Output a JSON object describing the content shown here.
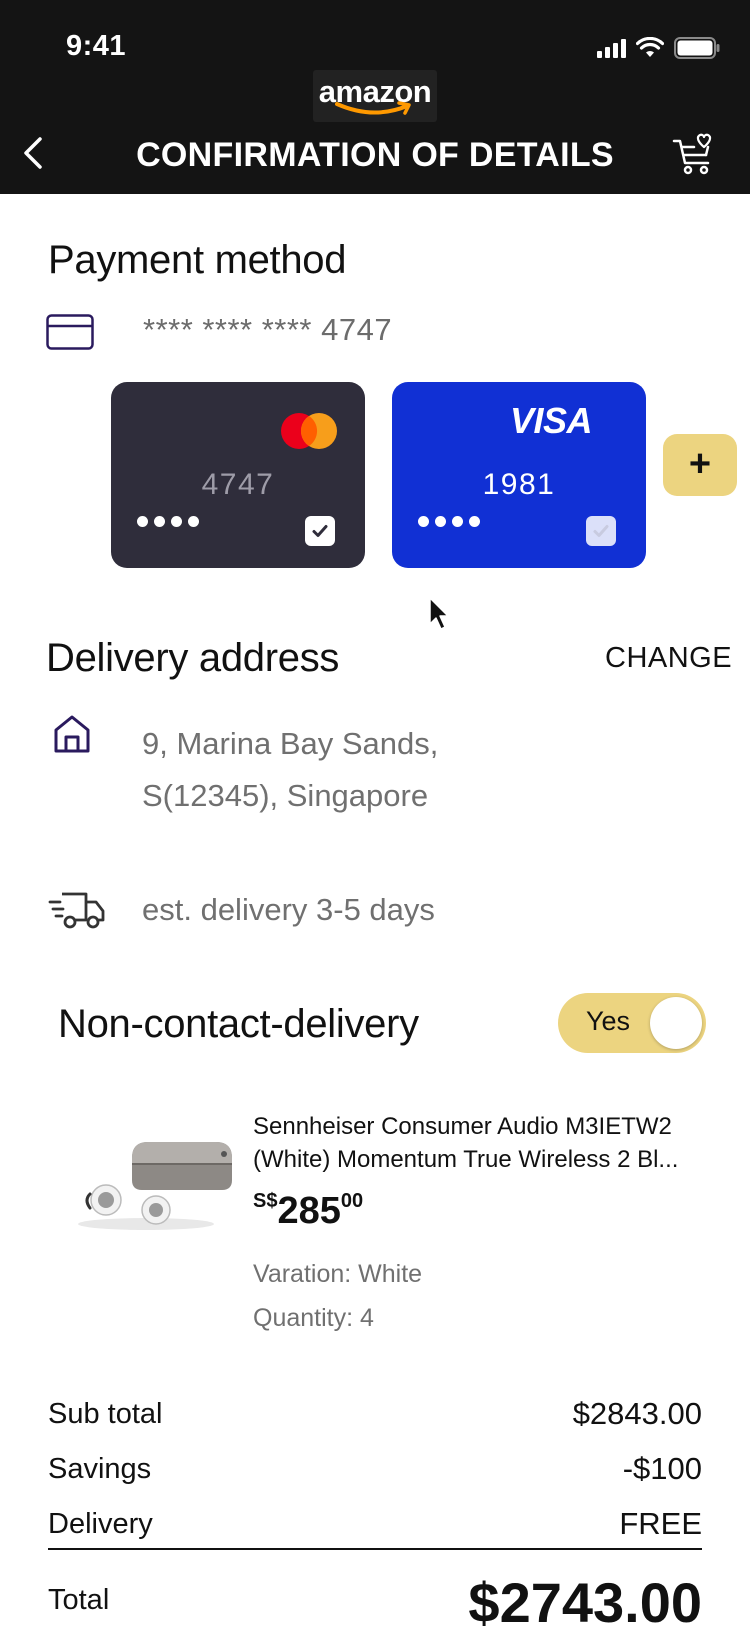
{
  "status_bar": {
    "time": "9:41"
  },
  "header": {
    "logo_text": "amazon",
    "title": "CONFIRMATION OF DETAILS"
  },
  "payment": {
    "title": "Payment method",
    "selected_card_number": "**** **** **** 4747",
    "cards": [
      {
        "brand": "mastercard",
        "number": "4747",
        "dots": "••••",
        "color": "#2f2d3b"
      },
      {
        "brand": "VISA",
        "number": "1981",
        "dots": "••••",
        "color": "#1130d4"
      }
    ],
    "add_label": "+"
  },
  "delivery": {
    "title": "Delivery address",
    "change_label": "CHANGE",
    "address_line1": "9, Marina Bay Sands,",
    "address_line2": "S(12345), Singapore",
    "estimate": "est. delivery 3-5 days"
  },
  "non_contact": {
    "label": "Non-contact-delivery",
    "toggle_label": "Yes",
    "enabled": true,
    "accent_color": "#ecd480"
  },
  "product": {
    "title": "Sennheiser Consumer Audio M3IETW2 (White) Momentum True Wireless 2 Bl...",
    "price_currency": "S$",
    "price_main": "285",
    "price_cents": "00",
    "variation": "Varation: White",
    "quantity": "Quantity: 4"
  },
  "summary": {
    "subtotal_label": "Sub total",
    "subtotal_value": "$2843.00",
    "savings_label": "Savings",
    "savings_value": "-$100",
    "delivery_label": "Delivery",
    "delivery_value": "FREE",
    "total_label": "Total",
    "total_value": "$2743.00"
  }
}
